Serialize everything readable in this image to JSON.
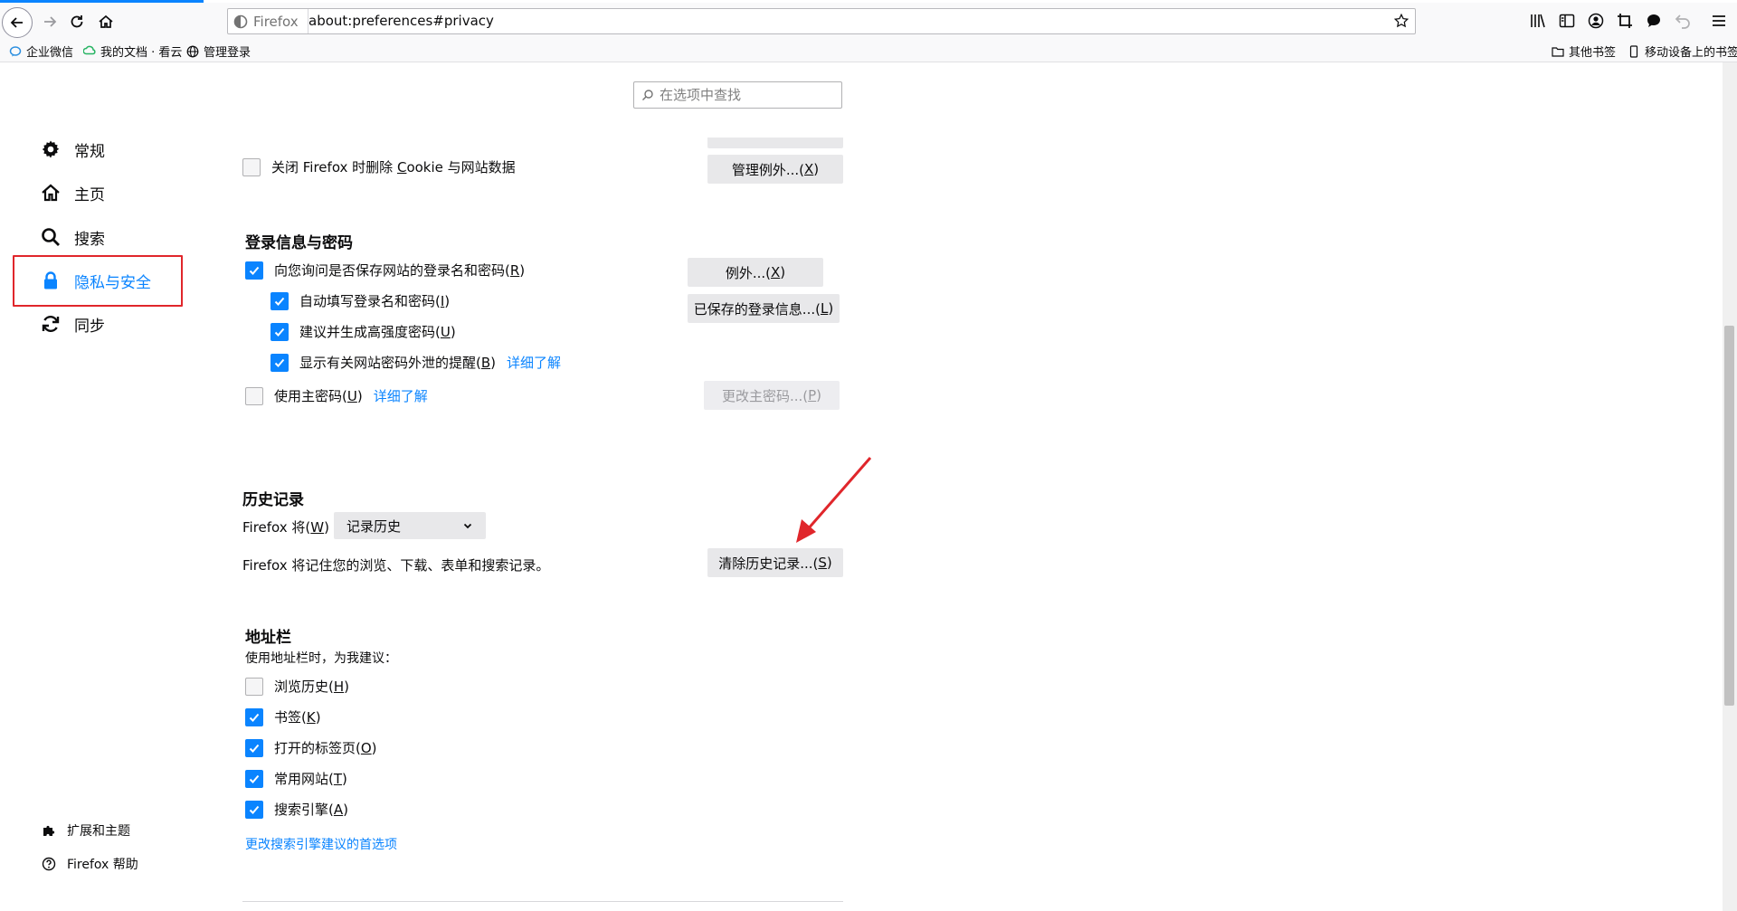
{
  "browser": {
    "identity_label": "Firefox",
    "url": "about:preferences#privacy",
    "bookmarks": [
      {
        "label": "企业微信",
        "icon": "wecom-icon"
      },
      {
        "label": "我的文档 · 看云",
        "icon": "kancloud-icon"
      },
      {
        "label": "管理登录",
        "icon": "globe-icon"
      }
    ],
    "bookmarks_right": [
      {
        "label": "其他书签",
        "icon": "folder-icon"
      },
      {
        "label": "移动设备上的书签",
        "icon": "mobile-icon"
      }
    ]
  },
  "search": {
    "placeholder": "在选项中查找"
  },
  "sidebar": {
    "categories": [
      {
        "label": "常规",
        "icon": "gear-icon"
      },
      {
        "label": "主页",
        "icon": "home-icon"
      },
      {
        "label": "搜索",
        "icon": "search-icon"
      },
      {
        "label": "隐私与安全",
        "icon": "lock-icon",
        "selected": true
      },
      {
        "label": "同步",
        "icon": "sync-icon"
      }
    ],
    "footer": [
      {
        "label": "扩展和主题",
        "icon": "puzzle-icon"
      },
      {
        "label": "Firefox 帮助",
        "icon": "help-icon"
      }
    ]
  },
  "cookies": {
    "delete_on_close_label_pre": "关闭 Firefox 时删除 ",
    "delete_on_close_accesskey": "C",
    "delete_on_close_label_post": "ookie 与网站数据",
    "delete_on_close_checked": false,
    "manage_exceptions_label": "管理例外...(",
    "manage_exceptions_key": "X",
    "manage_exceptions_close": ")"
  },
  "logins": {
    "heading": "登录信息与密码",
    "ask_to_save": {
      "label": "向您询问是否保存网站的登录名和密码(",
      "key": "R",
      "close": ")",
      "checked": true
    },
    "autofill": {
      "label": "自动填写登录名和密码(",
      "key": "I",
      "close": ")",
      "checked": true
    },
    "suggest": {
      "label": "建议并生成高强度密码(",
      "key": "U",
      "close": ")",
      "checked": true
    },
    "breach": {
      "label": "显示有关网站密码外泄的提醒(",
      "key": "B",
      "close": ")",
      "checked": true,
      "learn_more": "详细了解"
    },
    "master": {
      "label": "使用主密码(",
      "key": "U",
      "close": ")",
      "checked": false,
      "learn_more": "详细了解"
    },
    "exceptions_btn": {
      "label": "例外...(",
      "key": "X",
      "close": ")"
    },
    "saved_btn": {
      "label": "已保存的登录信息...(",
      "key": "L",
      "close": ")"
    },
    "change_master_btn": {
      "label": "更改主密码...(",
      "key": "P",
      "close": ")"
    }
  },
  "history": {
    "heading": "历史记录",
    "will_label": "Firefox 将(",
    "will_key": "W",
    "will_close": ")",
    "mode": "记录历史",
    "description": "Firefox 将记住您的浏览、下载、表单和搜索记录。",
    "clear_btn": {
      "label": "清除历史记录...(",
      "key": "S",
      "close": ")"
    }
  },
  "address_bar": {
    "heading": "地址栏",
    "intro": "使用地址栏时，为我建议：",
    "options": [
      {
        "label": "浏览历史(",
        "key": "H",
        "close": ")",
        "checked": false
      },
      {
        "label": "书签(",
        "key": "K",
        "close": ")",
        "checked": true
      },
      {
        "label": "打开的标签页(",
        "key": "O",
        "close": ")",
        "checked": true
      },
      {
        "label": "常用网站(",
        "key": "T",
        "close": ")",
        "checked": true
      },
      {
        "label": "搜索引擎(",
        "key": "A",
        "close": ")",
        "checked": true
      }
    ],
    "change_prefs_link": "更改搜索引擎建议的首选项"
  },
  "colors": {
    "accent": "#0a84ff",
    "annotation_red": "#e0262b"
  }
}
